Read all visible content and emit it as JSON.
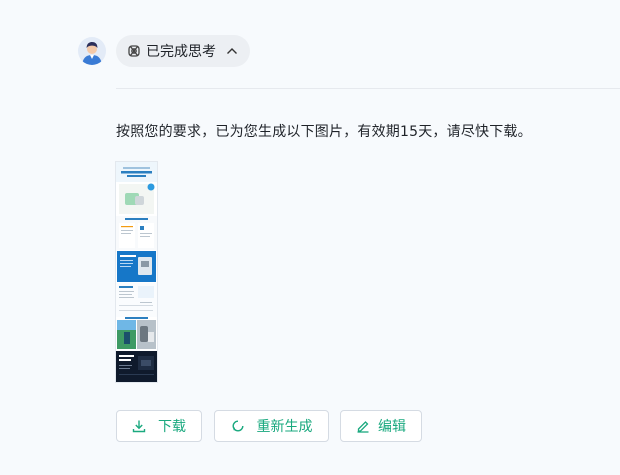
{
  "thinking": {
    "label": "已完成思考",
    "icon": "bot-icon",
    "toggle_icon": "chevron-up-icon"
  },
  "message": {
    "text": "按照您的要求，已为您生成以下图片，有效期15天，请尽快下载。"
  },
  "image": {
    "alt": "生成的图片缩略图"
  },
  "actions": {
    "download": {
      "label": "下载",
      "icon": "download-icon"
    },
    "regenerate": {
      "label": "重新生成",
      "icon": "refresh-icon"
    },
    "edit": {
      "label": "编辑",
      "icon": "pencil-icon"
    }
  },
  "colors": {
    "accent": "#1aa97f",
    "background": "#f7fafd",
    "pill": "#eceff3"
  }
}
